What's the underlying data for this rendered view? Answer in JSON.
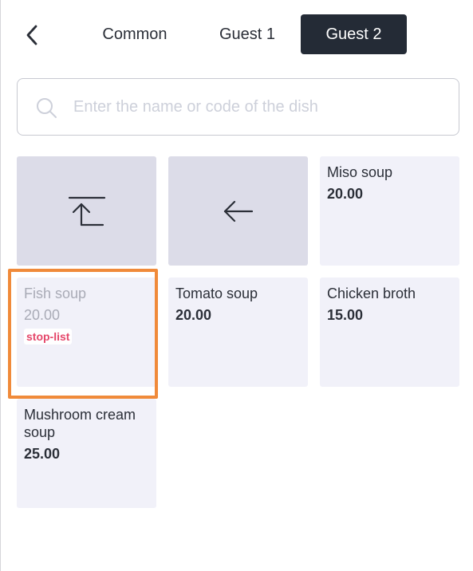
{
  "header": {
    "tabs": [
      {
        "label": "Common"
      },
      {
        "label": "Guest 1"
      },
      {
        "label": "Guest 2"
      }
    ],
    "active_tab": "Guest 2"
  },
  "search": {
    "placeholder": "Enter the name or code of the dish",
    "value": ""
  },
  "nav_tiles": {
    "up_icon": "move-to-top-icon",
    "back_icon": "arrow-left-icon"
  },
  "dishes": [
    {
      "name": "Miso soup",
      "price": "20.00"
    },
    {
      "name": "Fish soup",
      "price": "20.00",
      "status": "stop-list"
    },
    {
      "name": "Tomato soup",
      "price": "20.00"
    },
    {
      "name": "Chicken broth",
      "price": "15.00"
    },
    {
      "name": "Mushroom cream soup",
      "price": "25.00"
    }
  ],
  "colors": {
    "active_tab_bg": "#242b36",
    "tile_bg": "#f1f1f9",
    "nav_tile_bg": "#dcdce8",
    "stop_list": "#e5476a",
    "highlight": "#f08a3a"
  }
}
